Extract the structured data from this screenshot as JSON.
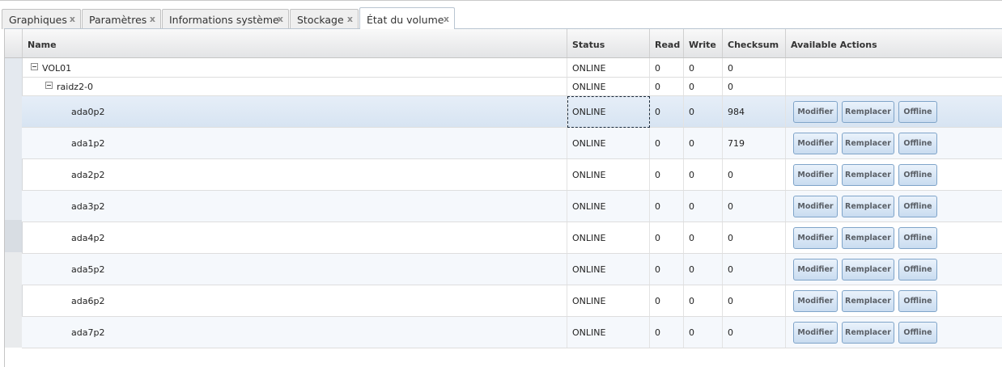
{
  "tabs": [
    {
      "label": "Graphiques",
      "close": "x",
      "active": false
    },
    {
      "label": "Paramètres",
      "close": "x",
      "active": false
    },
    {
      "label": "Informations système",
      "close": "x",
      "active": false
    },
    {
      "label": "Stockage",
      "close": "x",
      "active": false
    },
    {
      "label": "État du volume",
      "close": "x",
      "active": true
    }
  ],
  "grid": {
    "columns": {
      "name": "Name",
      "status": "Status",
      "read": "Read",
      "write": "Write",
      "checksum": "Checksum",
      "actions": "Available Actions"
    },
    "pool": {
      "name": "VOL01",
      "status": "ONLINE",
      "read": "0",
      "write": "0",
      "checksum": "0"
    },
    "vdev": {
      "name": "raidz2-0",
      "status": "ONLINE",
      "read": "0",
      "write": "0",
      "checksum": "0"
    },
    "disks": [
      {
        "name": "ada0p2",
        "status": "ONLINE",
        "read": "0",
        "write": "0",
        "checksum": "984"
      },
      {
        "name": "ada1p2",
        "status": "ONLINE",
        "read": "0",
        "write": "0",
        "checksum": "719"
      },
      {
        "name": "ada2p2",
        "status": "ONLINE",
        "read": "0",
        "write": "0",
        "checksum": "0"
      },
      {
        "name": "ada3p2",
        "status": "ONLINE",
        "read": "0",
        "write": "0",
        "checksum": "0"
      },
      {
        "name": "ada4p2",
        "status": "ONLINE",
        "read": "0",
        "write": "0",
        "checksum": "0"
      },
      {
        "name": "ada5p2",
        "status": "ONLINE",
        "read": "0",
        "write": "0",
        "checksum": "0"
      },
      {
        "name": "ada6p2",
        "status": "ONLINE",
        "read": "0",
        "write": "0",
        "checksum": "0"
      },
      {
        "name": "ada7p2",
        "status": "ONLINE",
        "read": "0",
        "write": "0",
        "checksum": "0"
      }
    ],
    "actions": {
      "edit": "Modifier",
      "replace": "Remplacer",
      "offline": "Offline"
    },
    "icons": {
      "expanded": "collapse-minus-icon"
    }
  }
}
